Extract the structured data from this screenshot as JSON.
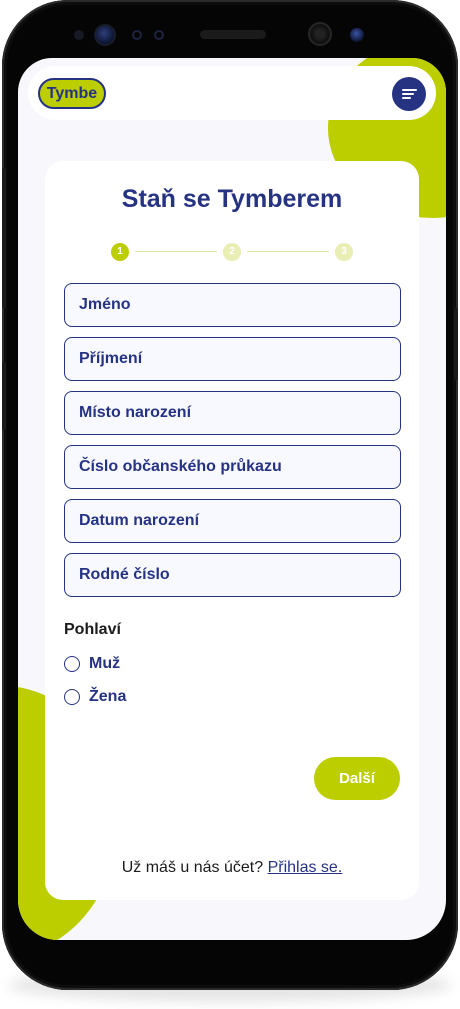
{
  "navbar": {
    "logo_text": "Tymbe",
    "menu_icon": "menu-icon"
  },
  "form": {
    "title": "Staň se Tymberem",
    "steps": [
      "1",
      "2",
      "3"
    ],
    "fields": [
      {
        "placeholder": "Jméno",
        "value": ""
      },
      {
        "placeholder": "Příjmení",
        "value": ""
      },
      {
        "placeholder": "Místo narození",
        "value": ""
      },
      {
        "placeholder": "Číslo občanského průkazu",
        "value": ""
      },
      {
        "placeholder": "Datum narození",
        "value": ""
      },
      {
        "placeholder": "Rodné číslo",
        "value": ""
      }
    ],
    "gender_label": "Pohlaví",
    "gender_options": [
      "Muž",
      "Žena"
    ],
    "next_button": "Další",
    "login_prompt": "Už máš u nás účet?",
    "login_link": "Přihlas se."
  },
  "colors": {
    "brand_navy": "#263383",
    "brand_lime": "#bccd00",
    "background": "#f7f7fc"
  }
}
